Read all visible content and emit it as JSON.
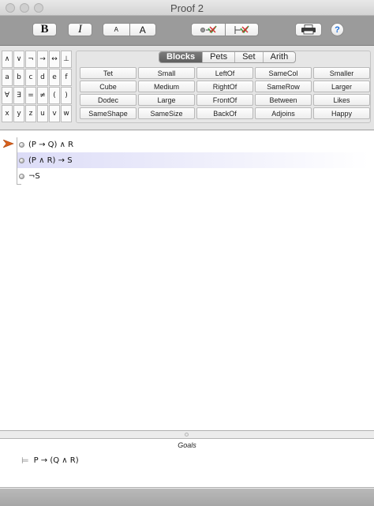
{
  "window": {
    "title": "Proof 2"
  },
  "toolbar": {
    "bold_label": "B",
    "italic_label": "I",
    "font_small_label": "A",
    "font_large_label": "A",
    "help_label": "?"
  },
  "symbols": [
    "∧",
    "∨",
    "¬",
    "→",
    "↔",
    "⊥",
    "a",
    "b",
    "c",
    "d",
    "e",
    "f",
    "∀",
    "∃",
    "=",
    "≠",
    "(",
    ")",
    "x",
    "y",
    "z",
    "u",
    "v",
    "w"
  ],
  "tabs": [
    "Blocks",
    "Pets",
    "Set",
    "Arith"
  ],
  "active_tab": "Blocks",
  "predicates": [
    "Tet",
    "Small",
    "LeftOf",
    "SameCol",
    "Smaller",
    "Cube",
    "Medium",
    "RightOf",
    "SameRow",
    "Larger",
    "Dodec",
    "Large",
    "FrontOf",
    "Between",
    "Likes",
    "SameShape",
    "SameSize",
    "BackOf",
    "Adjoins",
    "Happy"
  ],
  "proof": {
    "steps": [
      "(P → Q) ∧ R",
      "(P ∧ R) → S",
      "¬S"
    ]
  },
  "goals": {
    "title": "Goals",
    "items": [
      "P → (Q ∧ R)"
    ]
  },
  "colors": {
    "pointer": "#d9601a",
    "toolbar": "#9b9b9b",
    "selected_row": "#dcdcf7"
  }
}
